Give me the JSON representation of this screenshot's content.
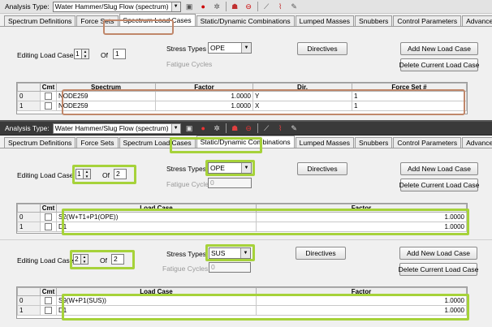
{
  "colors": {
    "orange_highlight": "#c0876a",
    "green_highlight": "#a6d23a"
  },
  "toolbar": {
    "label": "Analysis Type:",
    "analysis_type": "Water Hammer/Slug Flow (spectrum)",
    "icons": [
      "calculator-icon",
      "stop-icon",
      "signal-tower-icon",
      "group-icon",
      "cancel-icon",
      "line-graph-icon",
      "chart-icon",
      "edit-chart-icon"
    ]
  },
  "tabs": [
    "Spectrum Definitions",
    "Force Sets",
    "Spectrum Load Cases",
    "Static/Dynamic Combinations",
    "Lumped Masses",
    "Snubbers",
    "Control Parameters",
    "Advanced"
  ],
  "panel1": {
    "editing_label": "Editing Load Case",
    "editing_value": "1",
    "of_label": "Of",
    "of_value": "1",
    "stress_label": "Stress Types",
    "stress_value": "OPE",
    "fatigue_label": "Fatigue Cycles",
    "directives": "Directives",
    "add": "Add New Load Case",
    "delete": "Delete Current Load Case",
    "columns": [
      "Cmt",
      "Spectrum",
      "Factor",
      "Dir.",
      "Force Set #"
    ],
    "rows": [
      {
        "idx": "0",
        "spectrum": "NODE259",
        "factor": "1.0000",
        "dir": "Y",
        "force_set": "1"
      },
      {
        "idx": "1",
        "spectrum": "NODE259",
        "factor": "1.0000",
        "dir": "X",
        "force_set": "1"
      }
    ]
  },
  "panel2": {
    "editing_label": "Editing Load Case",
    "editing_value": "1",
    "of_label": "Of",
    "of_value": "2",
    "stress_label": "Stress Types",
    "stress_value": "OPE",
    "fatigue_label": "Fatigue Cycles",
    "fatigue_value": "0",
    "directives": "Directives",
    "add": "Add New Load Case",
    "delete": "Delete Current Load Case",
    "columns": [
      "Cmt",
      "Load Case",
      "Factor"
    ],
    "rows": [
      {
        "idx": "0",
        "load_case": "S2(W+T1+P1(OPE))",
        "factor": "1.0000"
      },
      {
        "idx": "1",
        "load_case": "D1",
        "factor": "1.0000"
      }
    ]
  },
  "panel3": {
    "editing_label": "Editing Load Case",
    "editing_value": "2",
    "of_label": "Of",
    "of_value": "2",
    "stress_label": "Stress Types",
    "stress_value": "SUS",
    "fatigue_label": "Fatigue Cycles",
    "fatigue_value": "0",
    "directives": "Directives",
    "add": "Add New Load Case",
    "delete": "Delete Current Load Case",
    "columns": [
      "Cmt",
      "Load Case",
      "Factor"
    ],
    "rows": [
      {
        "idx": "0",
        "load_case": "S9(W+P1(SUS))",
        "factor": "1.0000"
      },
      {
        "idx": "1",
        "load_case": "D1",
        "factor": "1.0000"
      }
    ]
  }
}
